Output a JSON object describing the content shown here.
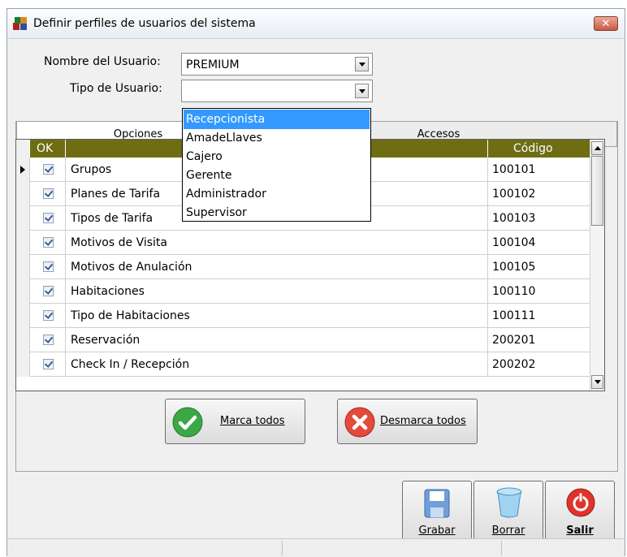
{
  "window": {
    "title": "Definir perfiles de usuarios del sistema",
    "close_label": "✕"
  },
  "form": {
    "user_label": "Nombre del Usuario:",
    "user_value": "PREMIUM",
    "type_label": "Tipo de Usuario:",
    "type_value": ""
  },
  "tabs": [
    "Opciones",
    "Accesos"
  ],
  "grid": {
    "headers": {
      "ok": "OK",
      "name": "",
      "code": "Código"
    },
    "rows": [
      {
        "name": "Grupos",
        "code": "100101",
        "checked": true
      },
      {
        "name": "Planes de Tarifa",
        "code": "100102",
        "checked": true
      },
      {
        "name": "Tipos de Tarifa",
        "code": "100103",
        "checked": true
      },
      {
        "name": "Motivos de Visita",
        "code": "100104",
        "checked": true
      },
      {
        "name": "Motivos de Anulación",
        "code": "100105",
        "checked": true
      },
      {
        "name": "Habitaciones",
        "code": "100110",
        "checked": true
      },
      {
        "name": "Tipo de Habitaciones",
        "code": "100111",
        "checked": true
      },
      {
        "name": "Reservación",
        "code": "200201",
        "checked": true
      },
      {
        "name": "Check In / Recepción",
        "code": "200202",
        "checked": true
      }
    ]
  },
  "buttons": {
    "mark_all": "Marca todos",
    "unmark_all": "Desmarca todos",
    "save": "Grabar",
    "delete": "Borrar",
    "exit": "Salir"
  },
  "dropdown": {
    "options": [
      "Recepcionista",
      "AmadeLlaves",
      "Cajero",
      "Gerente",
      "Administrador",
      "Supervisor"
    ],
    "selected_index": 0
  },
  "colors": {
    "header_bg": "#6e6d14",
    "selection": "#3399ff"
  },
  "icons": {
    "app": "app-cubes-icon",
    "check": "green-check-icon",
    "cancel": "red-x-icon",
    "save": "floppy-disk-icon",
    "delete": "trash-bin-icon",
    "exit": "power-icon"
  }
}
